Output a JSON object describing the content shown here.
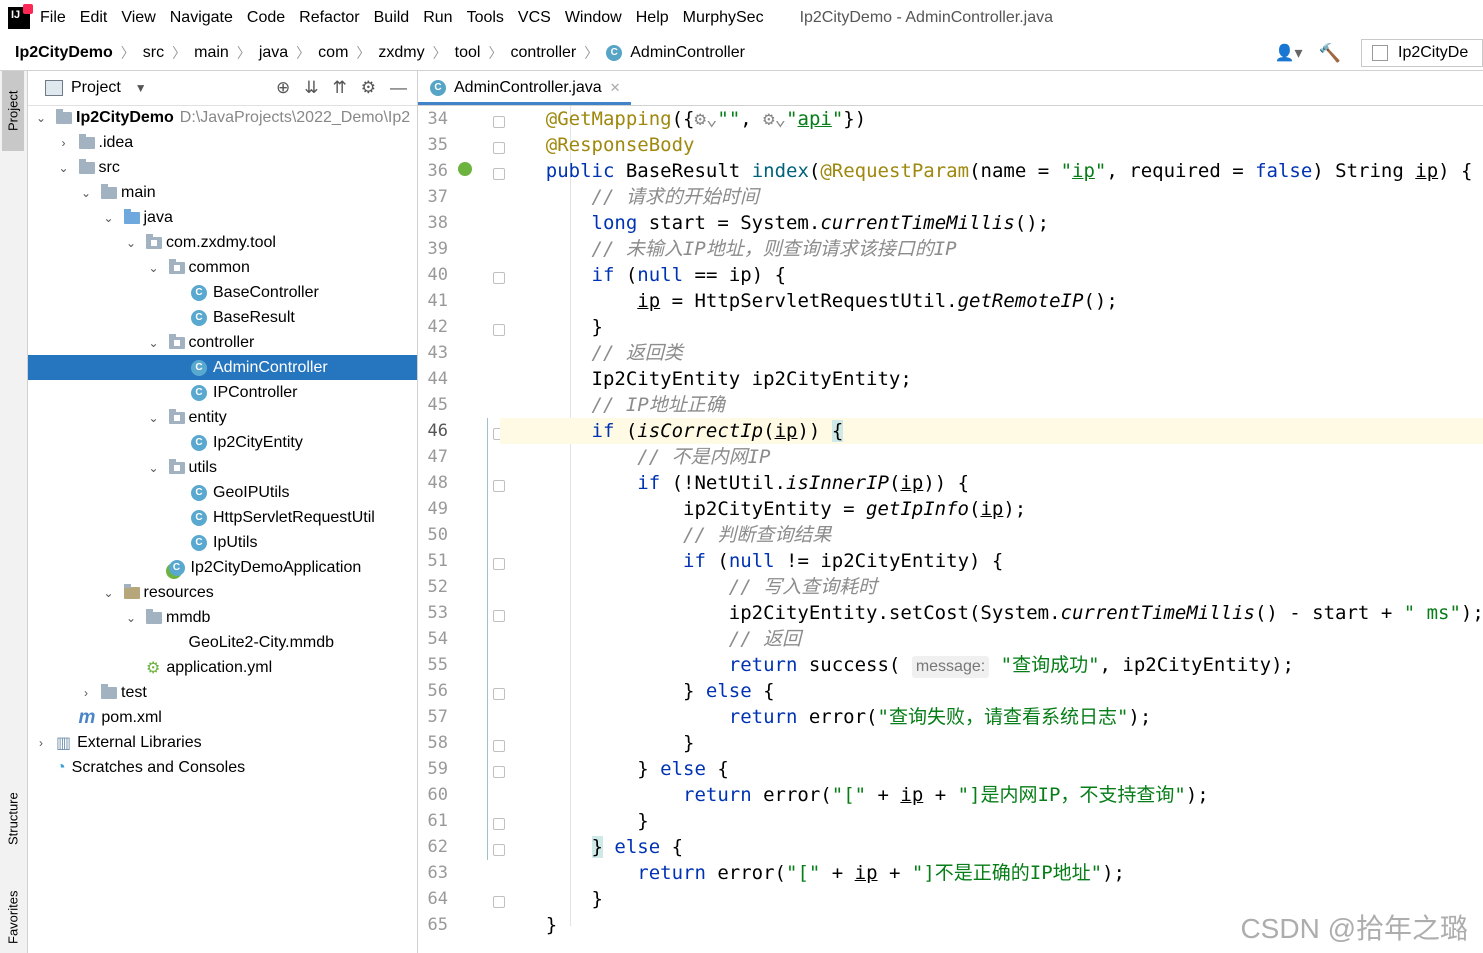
{
  "menu": {
    "items": [
      "File",
      "Edit",
      "View",
      "Navigate",
      "Code",
      "Refactor",
      "Build",
      "Run",
      "Tools",
      "VCS",
      "Window",
      "Help",
      "MurphySec"
    ],
    "window_title": "Ip2CityDemo - AdminController.java"
  },
  "breadcrumb": {
    "items": [
      "Ip2CityDemo",
      "src",
      "main",
      "java",
      "com",
      "zxdmy",
      "tool",
      "controller"
    ],
    "current": "AdminController",
    "run_config": "Ip2CityDe"
  },
  "stripe": {
    "project": "Project",
    "structure": "Structure",
    "favorites": "Favorites"
  },
  "project_panel": {
    "title": "Project",
    "root_path": "D:\\JavaProjects\\2022_Demo\\Ip2",
    "tree": [
      {
        "label": "Ip2CityDemo",
        "depth": 0,
        "arrow": "v",
        "icon": "folder",
        "bold": true
      },
      {
        "label": ".idea",
        "depth": 1,
        "arrow": ">",
        "icon": "folder"
      },
      {
        "label": "src",
        "depth": 1,
        "arrow": "v",
        "icon": "folder"
      },
      {
        "label": "main",
        "depth": 2,
        "arrow": "v",
        "icon": "folder"
      },
      {
        "label": "java",
        "depth": 3,
        "arrow": "v",
        "icon": "folder-blue"
      },
      {
        "label": "com.zxdmy.tool",
        "depth": 4,
        "arrow": "v",
        "icon": "package"
      },
      {
        "label": "common",
        "depth": 5,
        "arrow": "v",
        "icon": "package"
      },
      {
        "label": "BaseController",
        "depth": 6,
        "arrow": "",
        "icon": "class"
      },
      {
        "label": "BaseResult",
        "depth": 6,
        "arrow": "",
        "icon": "class"
      },
      {
        "label": "controller",
        "depth": 5,
        "arrow": "v",
        "icon": "package"
      },
      {
        "label": "AdminController",
        "depth": 6,
        "arrow": "",
        "icon": "class",
        "selected": true
      },
      {
        "label": "IPController",
        "depth": 6,
        "arrow": "",
        "icon": "class"
      },
      {
        "label": "entity",
        "depth": 5,
        "arrow": "v",
        "icon": "package"
      },
      {
        "label": "Ip2CityEntity",
        "depth": 6,
        "arrow": "",
        "icon": "class"
      },
      {
        "label": "utils",
        "depth": 5,
        "arrow": "v",
        "icon": "package"
      },
      {
        "label": "GeoIPUtils",
        "depth": 6,
        "arrow": "",
        "icon": "class"
      },
      {
        "label": "HttpServletRequestUtil",
        "depth": 6,
        "arrow": "",
        "icon": "class"
      },
      {
        "label": "IpUtils",
        "depth": 6,
        "arrow": "",
        "icon": "class"
      },
      {
        "label": "Ip2CityDemoApplication",
        "depth": 5,
        "arrow": "",
        "icon": "spring-class"
      },
      {
        "label": "resources",
        "depth": 3,
        "arrow": "v",
        "icon": "resources"
      },
      {
        "label": "mmdb",
        "depth": 4,
        "arrow": "v",
        "icon": "folder"
      },
      {
        "label": "GeoLite2-City.mmdb",
        "depth": 5,
        "arrow": "",
        "icon": "file"
      },
      {
        "label": "application.yml",
        "depth": 4,
        "arrow": "",
        "icon": "yml"
      },
      {
        "label": "test",
        "depth": 2,
        "arrow": ">",
        "icon": "folder"
      },
      {
        "label": "pom.xml",
        "depth": 1,
        "arrow": "",
        "icon": "maven"
      },
      {
        "label": "External Libraries",
        "depth": 0,
        "arrow": ">",
        "icon": "libraries"
      },
      {
        "label": "Scratches and Consoles",
        "depth": 0,
        "arrow": "",
        "icon": "scratches"
      }
    ]
  },
  "editor": {
    "tab": "AdminController.java",
    "line_numbers": [
      "34",
      "35",
      "36",
      "37",
      "38",
      "39",
      "40",
      "41",
      "42",
      "43",
      "44",
      "45",
      "46",
      "47",
      "48",
      "49",
      "50",
      "51",
      "52",
      "53",
      "54",
      "55",
      "56",
      "57",
      "58",
      "59",
      "60",
      "61",
      "62",
      "63",
      "64",
      "65"
    ],
    "current_line": "46",
    "hint_message": "message:"
  },
  "watermark": "CSDN @拾年之璐",
  "colors": {
    "keyword": "#0033b3",
    "annotation": "#9e880d",
    "string": "#067d17",
    "comment": "#8c8c8c",
    "selection": "#2675bf"
  }
}
